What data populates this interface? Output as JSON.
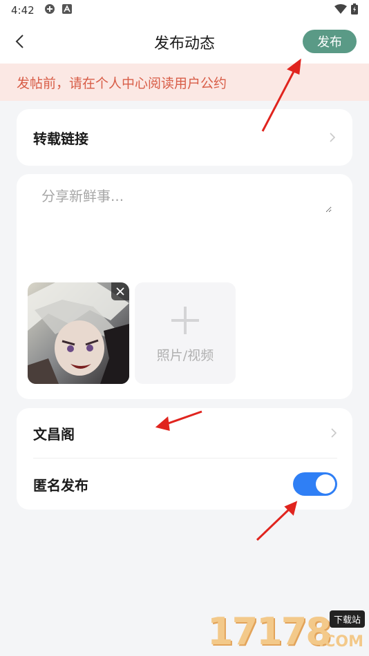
{
  "status_bar": {
    "time": "4:42"
  },
  "header": {
    "title": "发布动态",
    "publish_label": "发布"
  },
  "notice": {
    "text": "发帖前，请在个人中心阅读用户公约"
  },
  "repost": {
    "label": "转载链接"
  },
  "compose": {
    "placeholder": "分享新鲜事..."
  },
  "media": {
    "add_label": "照片/视频"
  },
  "options": {
    "circle_label": "文昌阁",
    "anonymous_label": "匿名发布",
    "anonymous_enabled": true
  },
  "watermark": {
    "digits": "17178",
    "tag": "下载站",
    "domain": ".COM"
  },
  "colors": {
    "publish_bg": "#5a9a86",
    "notice_bg": "#fbe8e4",
    "notice_text": "#d85d47",
    "toggle_on": "#2f7ff5",
    "annotation_arrow": "#e0241e"
  }
}
